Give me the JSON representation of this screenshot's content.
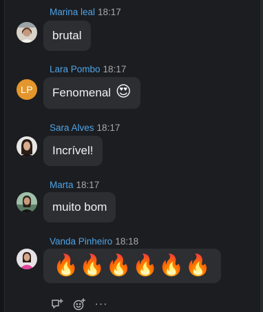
{
  "messages": [
    {
      "sender": "Marina leal",
      "time": "18:17",
      "text": "brutal"
    },
    {
      "sender": "Lara Pombo",
      "time": "18:17",
      "text": "Fenomenal",
      "emoji": "😍",
      "initials": "LP"
    },
    {
      "sender": "Sara Alves",
      "time": "18:17",
      "text": "Incrível!"
    },
    {
      "sender": "Marta",
      "time": "18:17",
      "text": "muito bom"
    },
    {
      "sender": "Vanda Pinheiro",
      "time": "18:18",
      "text": "🔥🔥🔥🔥🔥🔥"
    }
  ],
  "actions": {
    "more_label": "···",
    "icons": [
      "reply-icon",
      "add-reaction-icon",
      "more-icon"
    ]
  },
  "colors": {
    "background": "#1c1d20",
    "bubble": "#2d2e32",
    "sender": "#4ea4e8",
    "timestamp": "#a8a9ad",
    "initials_avatar": "#e3962b"
  }
}
